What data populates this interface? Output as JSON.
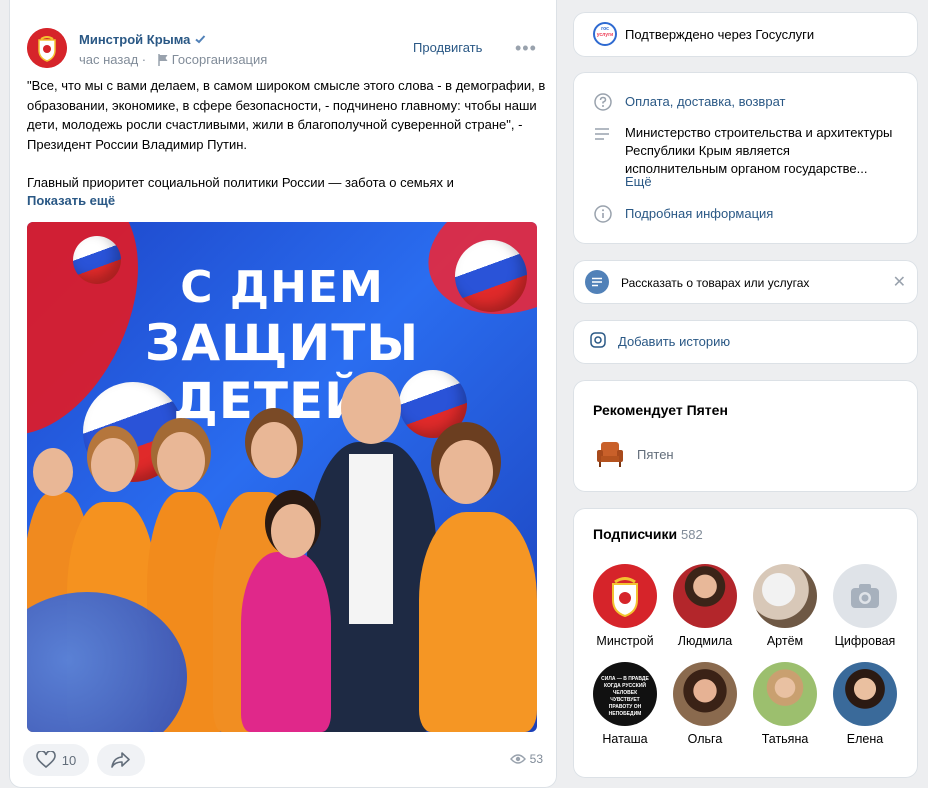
{
  "post": {
    "author": "Минстрой Крыма",
    "time": "час назад",
    "org_type": "Госорганизация",
    "promote_label": "Продвигать",
    "text_p1": "\"Все, что мы с вами делаем, в самом широком смысле этого слова - в демографии, в образовании, экономике, в сфере безопасности, - подчинено главному: чтобы наши дети, молодежь росли счастливыми, жили в благополучной суверенной стране\", - Президент России Владимир Путин.",
    "text_p2": "Главный приоритет социальной политики России — забота о семьях и",
    "show_more": "Показать ещё",
    "image_title_1": "С ДНЕМ",
    "image_title_2": "ЗАЩИТЫ ДЕТЕЙ!",
    "likes": "10",
    "views": "53"
  },
  "gosuslugi": {
    "label": "Подтверждено через Госуслуги",
    "logo_text_1": "гос",
    "logo_text_2": "услуги"
  },
  "info": {
    "payment_link": "Оплата, доставка, возврат",
    "description": "Министерство строительства и архитектуры Республики Крым является исполнительным органом государстве...",
    "more_link": "Ещё",
    "details_link": "Подробная информация"
  },
  "products": {
    "label": "Рассказать о товарах или услугах"
  },
  "story": {
    "label": "Добавить историю"
  },
  "recommend": {
    "title": "Рекомендует Пятен",
    "item": "Пятен"
  },
  "subscribers": {
    "title": "Подписчики",
    "count": "582",
    "items": [
      {
        "name": "Минстрой"
      },
      {
        "name": "Людмила"
      },
      {
        "name": "Артём"
      },
      {
        "name": "Цифровая"
      },
      {
        "name": "Наташа"
      },
      {
        "name": "Ольга"
      },
      {
        "name": "Татьяна"
      },
      {
        "name": "Елена"
      }
    ],
    "natasha_avatar_text": "СИЛА — В ПРАВДЕ КОГДА РУССКИЙ ЧЕЛОВЕК ЧУВСТВУЕТ ПРАВОТУ ОН НЕПОБЕДИМ"
  },
  "colors": {
    "link": "#2a5885",
    "background": "#edeef0",
    "accent_blue": "#5181b8"
  }
}
